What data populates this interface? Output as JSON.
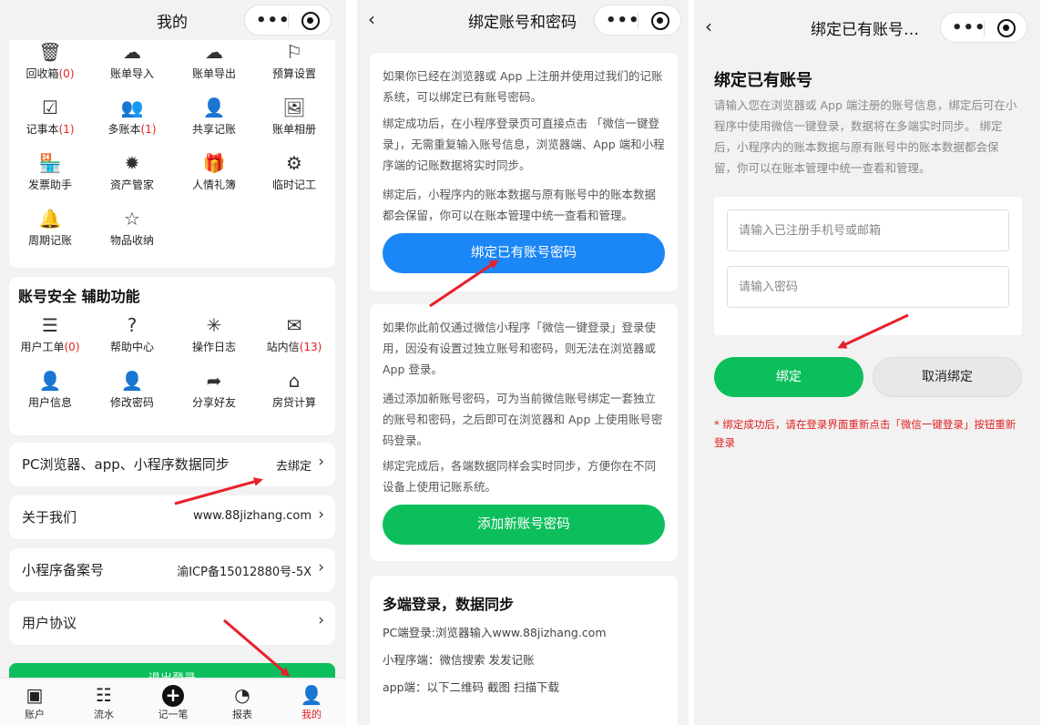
{
  "panel1": {
    "title": "我的",
    "grid1": [
      {
        "icon": "trash-icon",
        "glyph": "🗑",
        "label": "回收箱",
        "count": "(0)"
      },
      {
        "icon": "cloud-upload-icon",
        "glyph": "☁",
        "label": "账单导入",
        "count": ""
      },
      {
        "icon": "cloud-download-icon",
        "glyph": "☁",
        "label": "账单导出",
        "count": ""
      },
      {
        "icon": "flag-icon",
        "glyph": "⚐",
        "label": "预算设置",
        "count": ""
      },
      {
        "icon": "calendar-check-icon",
        "glyph": "☑",
        "label": "记事本",
        "count": "(1)"
      },
      {
        "icon": "users-icon",
        "glyph": "👥",
        "label": "多账本",
        "count": "(1)"
      },
      {
        "icon": "user-plus-icon",
        "glyph": "👤",
        "label": "共享记账",
        "count": ""
      },
      {
        "icon": "image-icon",
        "glyph": "🖼",
        "label": "账单相册",
        "count": ""
      },
      {
        "icon": "store-icon",
        "glyph": "🏪",
        "label": "发票助手",
        "count": ""
      },
      {
        "icon": "aperture-icon",
        "glyph": "✹",
        "label": "资产管家",
        "count": ""
      },
      {
        "icon": "gift-icon",
        "glyph": "🎁",
        "label": "人情礼簿",
        "count": ""
      },
      {
        "icon": "sliders-icon",
        "glyph": "⚙",
        "label": "临时记工",
        "count": ""
      },
      {
        "icon": "bell-icon",
        "glyph": "🔔",
        "label": "周期记账",
        "count": ""
      },
      {
        "icon": "star-icon",
        "glyph": "☆",
        "label": "物品收纳",
        "count": ""
      }
    ],
    "section_title": "账号安全  辅助功能",
    "grid2": [
      {
        "icon": "settings-sliders-icon",
        "glyph": "☰",
        "label": "用户工单",
        "count": "(0)"
      },
      {
        "icon": "help-icon",
        "glyph": "?",
        "label": "帮助中心",
        "count": ""
      },
      {
        "icon": "loading-icon",
        "glyph": "✳",
        "label": "操作日志",
        "count": ""
      },
      {
        "icon": "mail-icon",
        "glyph": "✉",
        "label": "站内信",
        "count": "(13)"
      },
      {
        "icon": "user-icon",
        "glyph": "👤",
        "label": "用户信息",
        "count": ""
      },
      {
        "icon": "user-edit-icon",
        "glyph": "👤",
        "label": "修改密码",
        "count": ""
      },
      {
        "icon": "share-icon",
        "glyph": "➦",
        "label": "分享好友",
        "count": ""
      },
      {
        "icon": "home-icon",
        "glyph": "⌂",
        "label": "房贷计算",
        "count": ""
      }
    ],
    "rows": [
      {
        "label": "PC浏览器、app、小程序数据同步",
        "value": "去绑定"
      },
      {
        "label": "关于我们",
        "value": "www.88jizhang.com"
      },
      {
        "label": "小程序备案号",
        "value": "渝ICP备15012880号-5X"
      },
      {
        "label": "用户协议",
        "value": ""
      }
    ],
    "logout": "退出登录",
    "tabs": [
      {
        "icon": "account-card-icon",
        "glyph": "▣",
        "label": "账户"
      },
      {
        "icon": "list-icon",
        "glyph": "☷",
        "label": "流水"
      },
      {
        "icon": "add-circle-icon",
        "glyph": "+",
        "label": "记一笔"
      },
      {
        "icon": "pie-chart-icon",
        "glyph": "◔",
        "label": "报表"
      },
      {
        "icon": "profile-icon",
        "glyph": "👤",
        "label": "我的"
      }
    ]
  },
  "panel2": {
    "title": "绑定账号和密码",
    "card1_paras": [
      "如果你已经在浏览器或 App 上注册并使用过我们的记账系统，可以绑定已有账号密码。",
      "绑定成功后，在小程序登录页可直接点击 「微信一键登录」，无需重复输入账号信息，浏览器端、App 端和小程序端的记账数据将实时同步。",
      "绑定后，小程序内的账本数据与原有账号中的账本数据都会保留，你可以在账本管理中统一查看和管理。"
    ],
    "bind_existing_btn": "绑定已有账号密码",
    "card2_paras": [
      "如果你此前仅通过微信小程序「微信一键登录」登录使用，因没有设置过独立账号和密码，则无法在浏览器或 App 登录。",
      "通过添加新账号密码，可为当前微信账号绑定一套独立的账号和密码，之后即可在浏览器和 App 上使用账号密码登录。",
      "绑定完成后，各端数据同样会实时同步，方便你在不同设备上使用记账系统。"
    ],
    "add_new_btn": "添加新账号密码",
    "sync_title": "多端登录，数据同步",
    "sync_lines": [
      "PC端登录:浏览器输入www.88jizhang.com",
      "小程序端：微信搜索 发发记账",
      "app端：以下二维码 截图 扫描下载"
    ]
  },
  "panel3": {
    "title": "绑定已有账号…",
    "heading": "绑定已有账号",
    "intro": "请输入您在浏览器或 App 端注册的账号信息，绑定后可在小程序中使用微信一键登录，数据将在多端实时同步。 绑定后，小程序内的账本数据与原有账号中的账本数据都会保留，你可以在账本管理中统一查看和管理。",
    "account_placeholder": "请输入已注册手机号或邮箱",
    "password_placeholder": "请输入密码",
    "bind_btn": "绑定",
    "unbind_btn": "取消绑定",
    "note": "* 绑定成功后，请在登录界面重新点击「微信一键登录」按钮重新登录"
  },
  "colors": {
    "accent_red": "#e02020",
    "green": "#0dbf5c",
    "blue": "#1b86f5",
    "arrow": "#e8202a"
  }
}
